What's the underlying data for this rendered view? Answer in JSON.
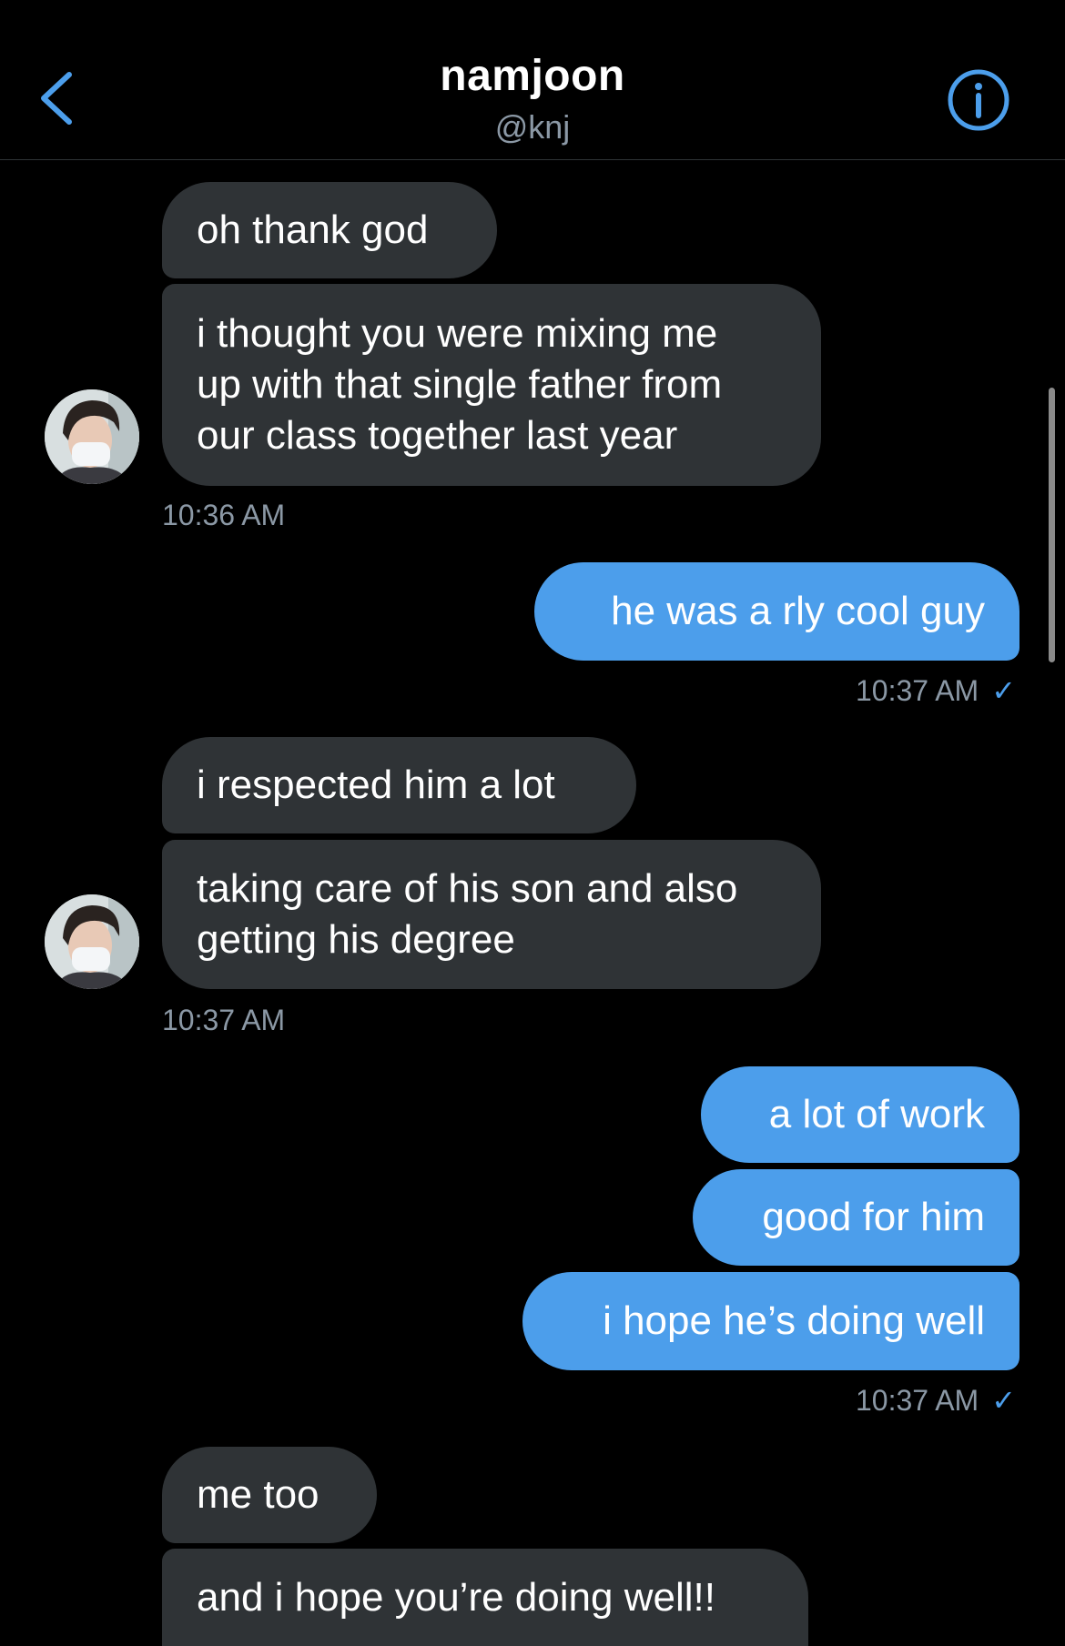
{
  "header": {
    "title": "namjoon",
    "handle": "@knj"
  },
  "colors": {
    "accent": "#4c9eeb",
    "received_bubble": "#2f3336",
    "background": "#000000",
    "muted_text": "#8b98a5"
  },
  "messages": {
    "m1": "oh thank god",
    "m2": [
      "i thought you were mixing me",
      "up with that single father from",
      "our class together last year"
    ],
    "ts1": "10:36 AM",
    "m3": "he was a rly cool guy",
    "ts2": "10:37 AM",
    "m4": "i respected him a lot",
    "m5": [
      "taking care of his son and also",
      "getting his degree"
    ],
    "ts3": "10:37 AM",
    "m6": "a lot of work",
    "m7": "good for him",
    "m8": "i hope he’s doing well",
    "ts4": "10:37 AM",
    "m9": "me too",
    "m10": "and i hope you’re doing well!!"
  },
  "icons": {
    "back": "chevron-left-icon",
    "info": "info-circle-icon",
    "read": "checkmark-icon",
    "read_glyph": "✓"
  }
}
